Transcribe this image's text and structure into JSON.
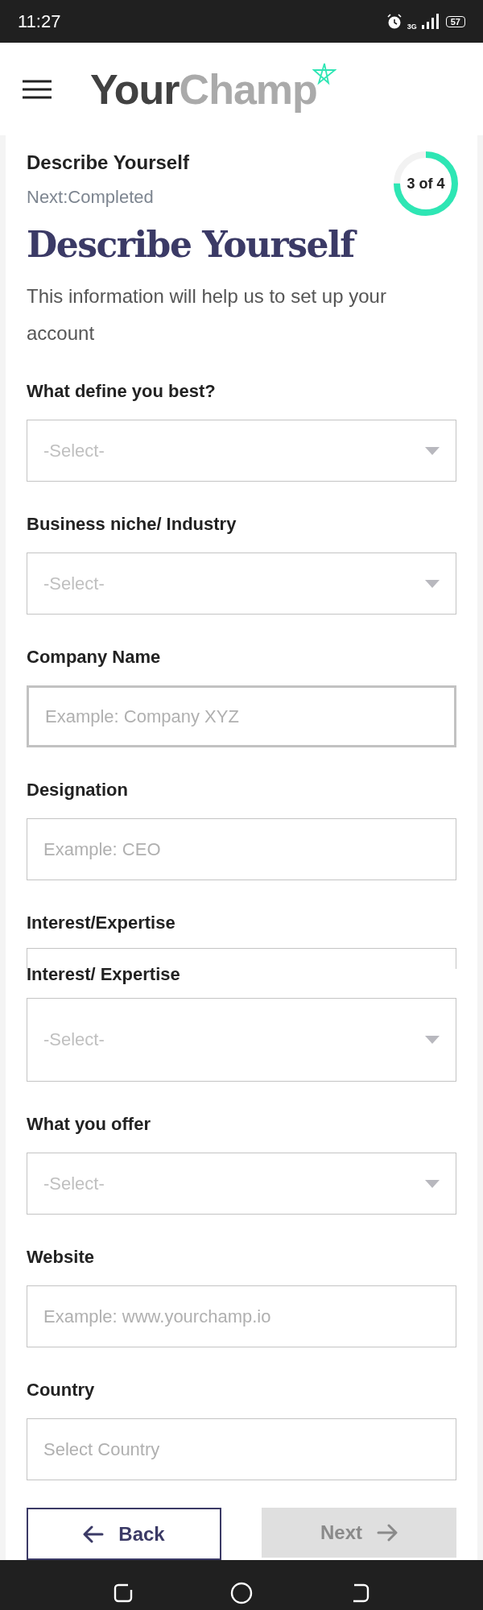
{
  "status_bar": {
    "time": "11:27",
    "network": "3G",
    "battery": "57"
  },
  "header": {
    "logo_dark": "Your",
    "logo_light": "Champ"
  },
  "step": {
    "title": "Describe Yourself",
    "next": "Next:Completed",
    "progress_text": "3 of 4",
    "level": 0.75
  },
  "heading": "Describe Yourself",
  "intro": "This information will help us to set up your account",
  "fields": [
    {
      "kind": "select",
      "label": "What define you best?",
      "placeholder": "-Select-",
      "focused": false
    },
    {
      "kind": "select",
      "label": "Business niche/ Industry",
      "placeholder": "-Select-",
      "focused": false
    },
    {
      "kind": "text",
      "label": "Company Name",
      "placeholder": "Example: Company XYZ",
      "focused": true
    },
    {
      "kind": "text",
      "label": "Designation",
      "placeholder": "Example: CEO",
      "focused": false
    },
    {
      "kind": "select",
      "label": "Interest/Expertise",
      "ghost_label": "Interest/ Expertise",
      "placeholder": "-Select-",
      "focused": false
    },
    {
      "kind": "select",
      "label": "What you offer",
      "placeholder": "-Select-",
      "focused": false
    },
    {
      "kind": "text",
      "label": "Website",
      "placeholder": "Example: www.yourchamp.io",
      "focused": false
    },
    {
      "kind": "text",
      "label": "Country",
      "placeholder": "Select Country",
      "focused": false
    }
  ],
  "buttons": [
    {
      "kind": "back",
      "label": "Back",
      "disabled": false
    },
    {
      "kind": "next",
      "label": "Next",
      "disabled": true
    }
  ]
}
